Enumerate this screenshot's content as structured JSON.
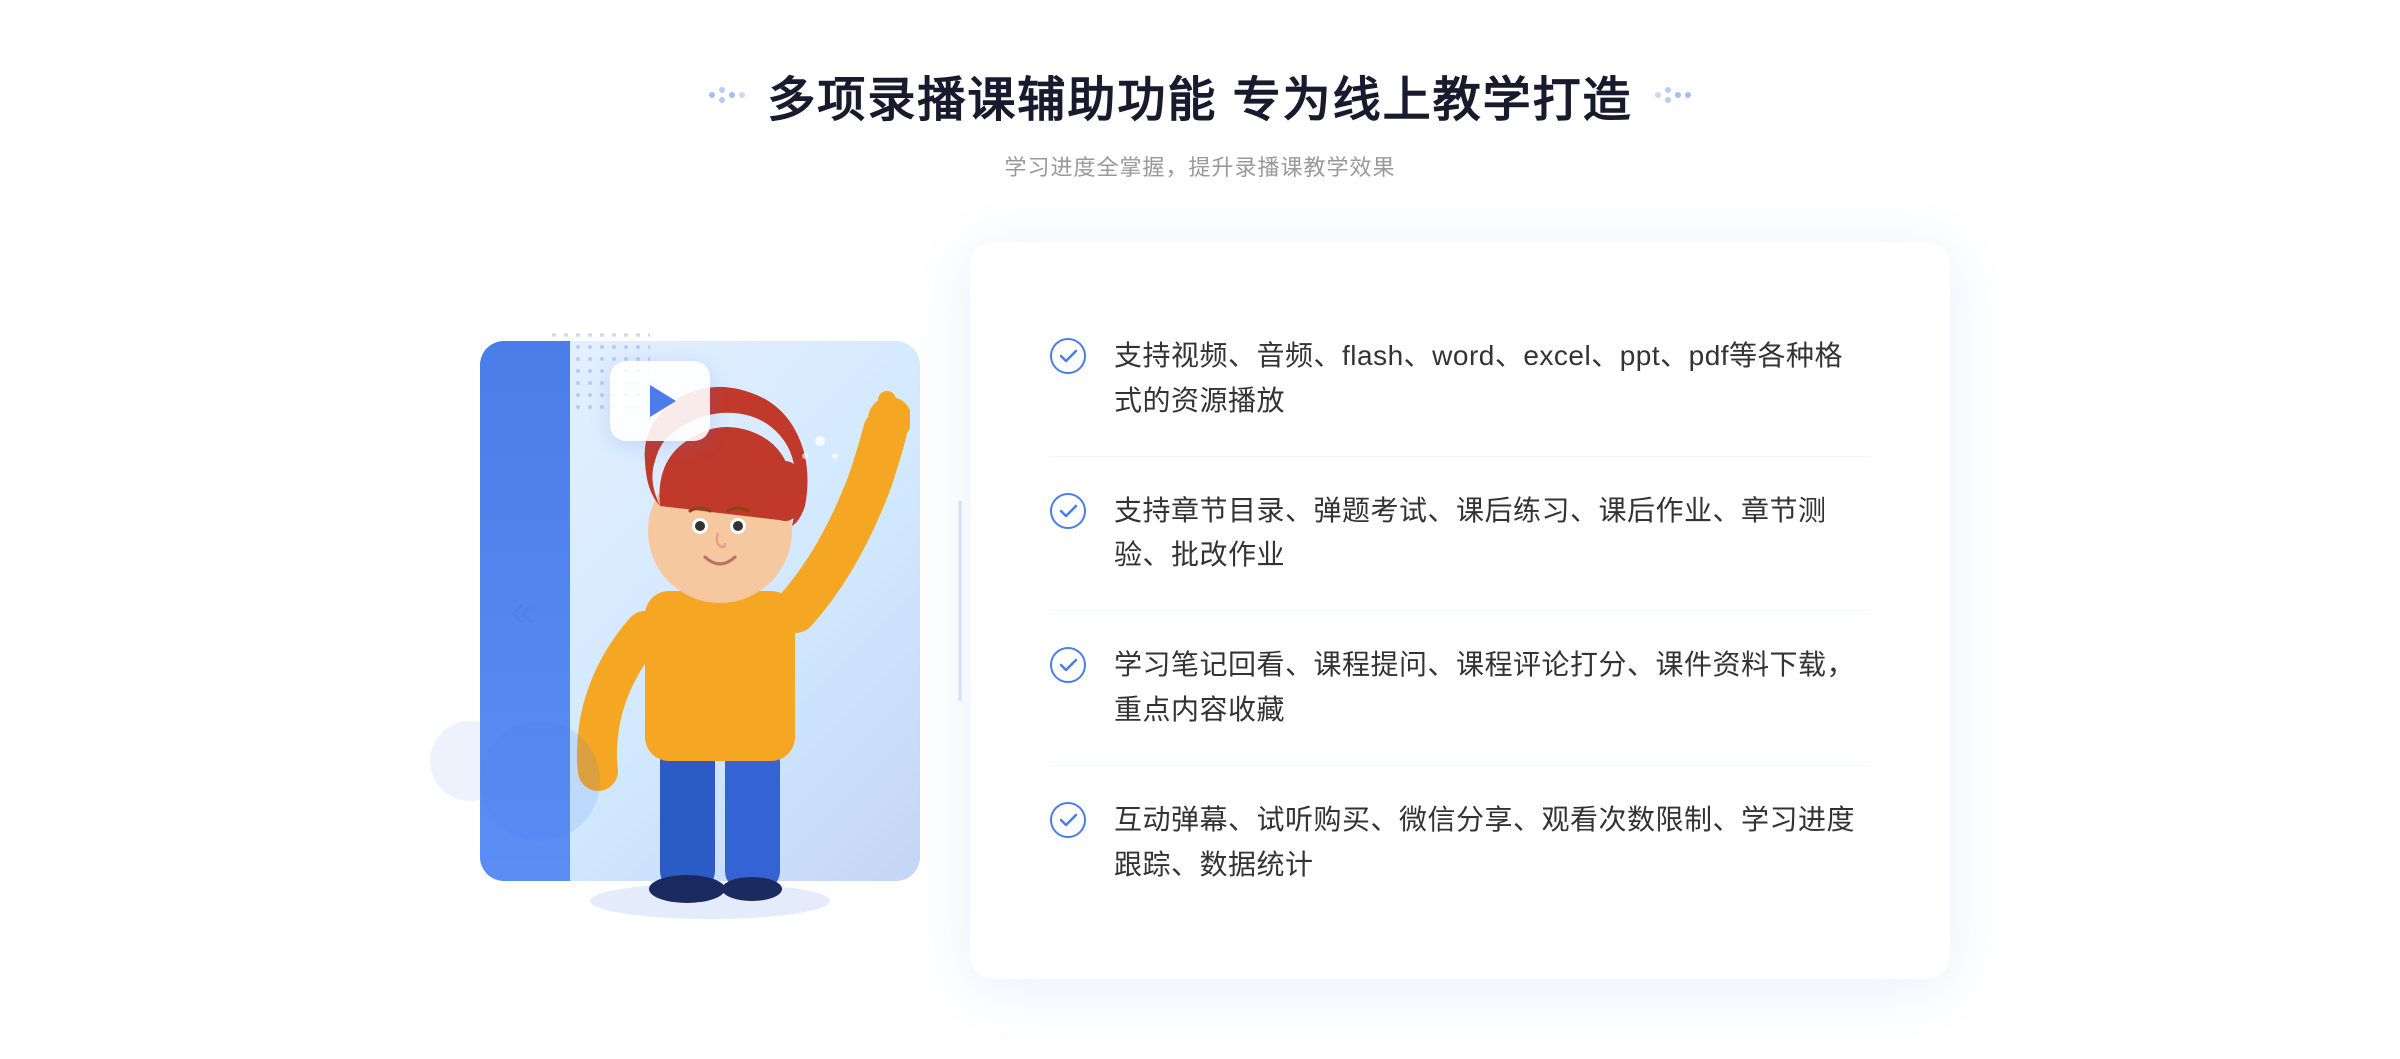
{
  "header": {
    "title": "多项录播课辅助功能 专为线上教学打造",
    "subtitle": "学习进度全掌握，提升录播课教学效果",
    "title_dots_label": "decorative dots"
  },
  "features": [
    {
      "id": 1,
      "text": "支持视频、音频、flash、word、excel、ppt、pdf等各种格式的资源播放"
    },
    {
      "id": 2,
      "text": "支持章节目录、弹题考试、课后练习、课后作业、章节测验、批改作业"
    },
    {
      "id": 3,
      "text": "学习笔记回看、课程提问、课程评论打分、课件资料下载，重点内容收藏"
    },
    {
      "id": 4,
      "text": "互动弹幕、试听购买、微信分享、观看次数限制、学习进度跟踪、数据统计"
    }
  ],
  "colors": {
    "blue_primary": "#4a7de8",
    "blue_light": "#d0e8ff",
    "blue_bg": "#e8f0fe",
    "text_dark": "#1a1a2e",
    "text_gray": "#999",
    "text_body": "#333"
  },
  "icons": {
    "check": "✓",
    "play": "▶",
    "arrows_left": "«"
  }
}
